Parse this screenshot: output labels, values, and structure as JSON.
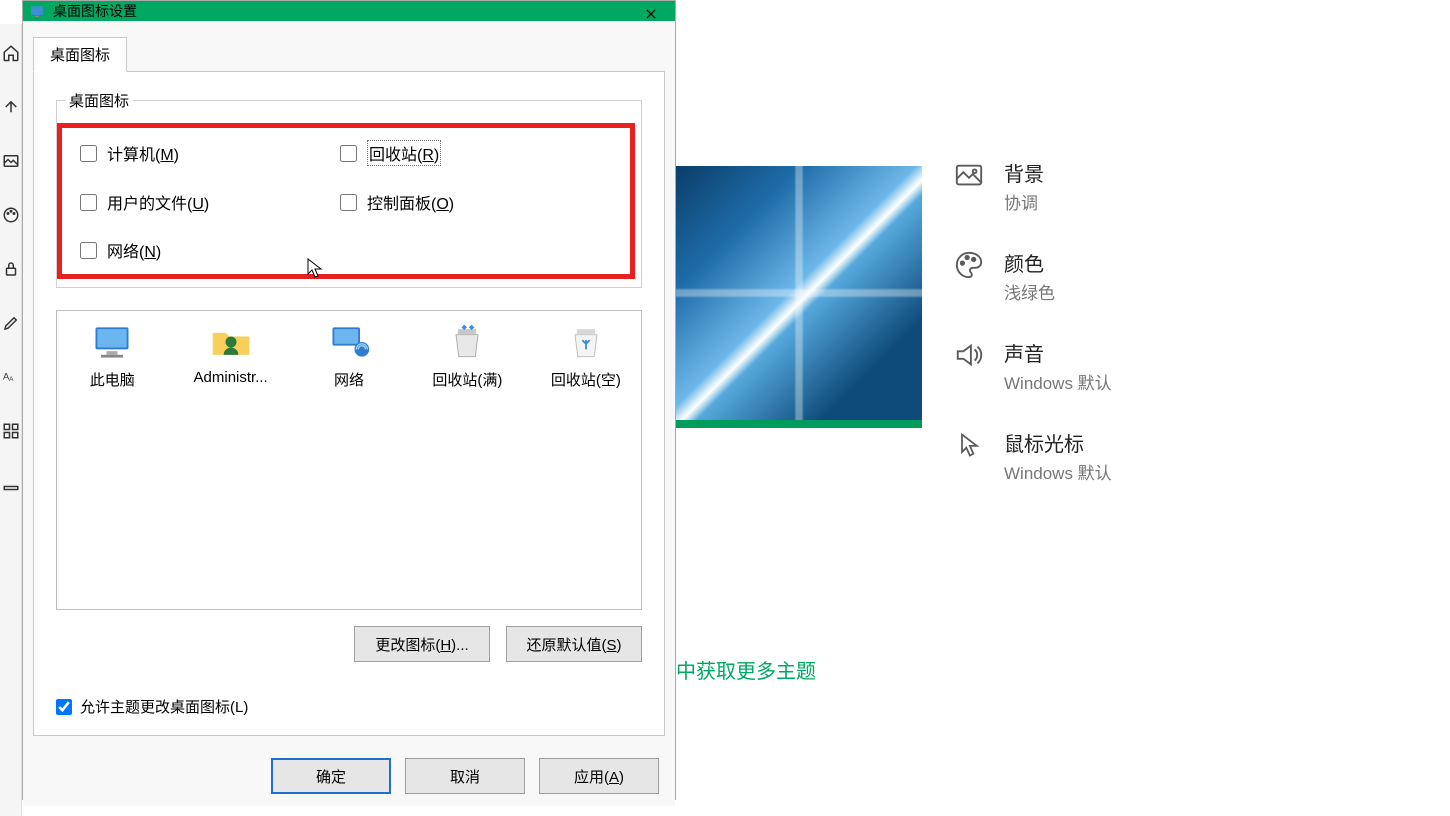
{
  "dialog": {
    "title": "桌面图标设置",
    "tab_label": "桌面图标",
    "group_legend": "桌面图标",
    "checks": {
      "computer": "计算机(",
      "computer_u": "M",
      "users_files": "用户的文件(",
      "users_files_u": "U",
      "network": "网络(",
      "network_u": "N",
      "recycle": "回收站(",
      "recycle_u": "R",
      "control": "控制面板(",
      "control_u": "O",
      "close_paren": ")"
    },
    "previews": {
      "this_pc": "此电脑",
      "admin": "Administr...",
      "network": "网络",
      "recycle_full": "回收站(满)",
      "recycle_empty": "回收站(空)"
    },
    "change_icon": "更改图标(",
    "change_icon_u": "H",
    "change_icon_tail": ")...",
    "restore_defaults": "还原默认值(",
    "restore_defaults_u": "S",
    "allow_theme": "允许主题更改桌面图标(",
    "allow_theme_u": "L",
    "ok": "确定",
    "cancel": "取消",
    "apply": "应用(",
    "apply_u": "A"
  },
  "right": {
    "items": [
      {
        "title": "背景",
        "sub": "协调"
      },
      {
        "title": "颜色",
        "sub": "浅绿色"
      },
      {
        "title": "声音",
        "sub": "Windows 默认"
      },
      {
        "title": "鼠标光标",
        "sub": "Windows 默认"
      }
    ],
    "theme_link": "中获取更多主题"
  }
}
